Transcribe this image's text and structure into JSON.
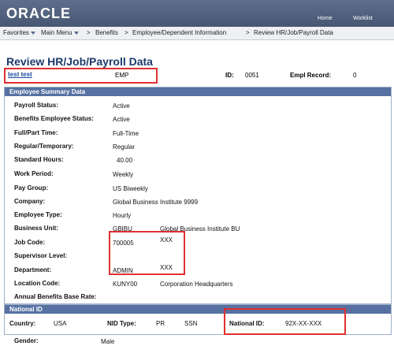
{
  "header": {
    "logo": "ORACLE",
    "home": "Home",
    "worklist": "Worklist"
  },
  "menu": {
    "favorites": "Favorites",
    "main_menu": "Main Menu",
    "sep": ">",
    "crumbs": [
      "Benefits",
      "Employee/Dependent Information",
      "Review HR/Job/Payroll Data"
    ]
  },
  "page": {
    "title": "Review HR/Job/Payroll Data"
  },
  "employee": {
    "name": "test test",
    "emp": "EMP",
    "id_label": "ID:",
    "id": "0051",
    "record_label": "Empl Record:",
    "record": "0"
  },
  "summary": {
    "header": "Employee Summary Data",
    "rows": [
      {
        "label": "Payroll Status:",
        "value": "Active",
        "extra": ""
      },
      {
        "label": "Benefits Employee Status:",
        "value": "Active",
        "extra": ""
      },
      {
        "label": "Full/Part Time:",
        "value": "Full-Time",
        "extra": ""
      },
      {
        "label": "Regular/Temporary:",
        "value": "Regular",
        "extra": ""
      },
      {
        "label": "Standard Hours:",
        "value": "40.00",
        "extra": ""
      },
      {
        "label": "Work Period:",
        "value": "Weekly",
        "extra": ""
      },
      {
        "label": "Pay Group:",
        "value": "US Biweekly",
        "extra": ""
      },
      {
        "label": "Company:",
        "value": "Global Business Institute 9999",
        "extra": ""
      },
      {
        "label": "Employee Type:",
        "value": "Hourly",
        "extra": ""
      },
      {
        "label": "Business Unit:",
        "value": "GBIBU",
        "extra": "Global Business Institute BU"
      },
      {
        "label": "Job Code:",
        "value": "700005",
        "extra": "XXX"
      },
      {
        "label": "Supervisor Level:",
        "value": "",
        "extra": ""
      },
      {
        "label": "Department:",
        "value": "ADMIN",
        "extra": "XXX"
      },
      {
        "label": "Location Code:",
        "value": "KUNY00",
        "extra": "Corporation Headquarters"
      },
      {
        "label": "Annual Benefits Base Rate:",
        "value": "",
        "extra": ""
      }
    ]
  },
  "national": {
    "header": "National ID",
    "country_label": "Country:",
    "country": "USA",
    "nid_label": "NID Type:",
    "nid_type": "PR",
    "nid_type2": "SSN",
    "nat_label": "National ID:",
    "nat_id": "92X-XX-XXX"
  },
  "gender": {
    "label": "Gender:",
    "value": "Male"
  }
}
